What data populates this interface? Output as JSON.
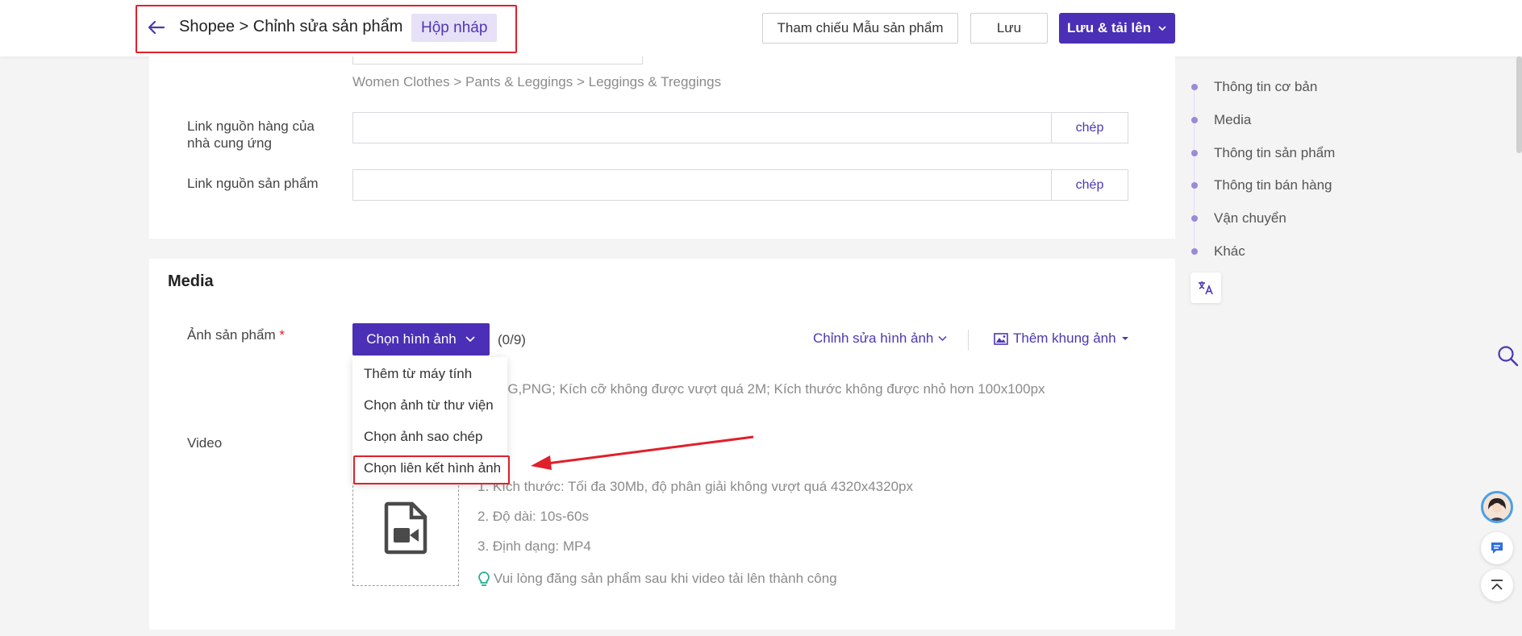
{
  "header": {
    "breadcrumb": "Shopee > Chỉnh sửa sản phẩm",
    "draft_badge": "Hộp nháp",
    "reference_button": "Tham chiếu Mẫu sản phẩm",
    "save_button": "Lưu",
    "save_upload_button": "Lưu & tải lên"
  },
  "basic": {
    "category_path": "Women Clothes > Pants & Leggings > Leggings & Treggings",
    "supplier_link_label": "Link nguồn hàng của nhà cung ứng",
    "supplier_link_value": "",
    "supplier_copy": "chép",
    "product_link_label": "Link nguồn sản phẩm",
    "product_link_value": "",
    "product_copy": "chép"
  },
  "media": {
    "title": "Media",
    "images_label": "Ảnh sản phẩm",
    "required_mark": "*",
    "choose_images_button": "Chọn hình ảnh",
    "image_count": "(0/9)",
    "edit_images": "Chỉnh sửa hình ảnh",
    "add_frame": "Thêm khung ảnh",
    "image_hint": "EG,PNG; Kích cỡ không được vượt quá 2M; Kích thước không được nhỏ hơn 100x100px",
    "dropdown": [
      "Thêm từ máy tính",
      "Chọn ảnh từ thư viện",
      "Chọn ảnh sao chép",
      "Chọn liên kết hình ảnh"
    ],
    "video_label": "Video",
    "video_req_1": "1. Kích thước: Tối đa 30Mb, độ phân giải không vượt quá 4320x4320px",
    "video_req_2": "2. Độ dài: 10s-60s",
    "video_req_3": "3. Định dạng: MP4",
    "video_tip": "Vui lòng đăng sản phẩm sau khi video tải lên thành công"
  },
  "right_nav": [
    "Thông tin cơ bản",
    "Media",
    "Thông tin sản phẩm",
    "Thông tin bán hàng",
    "Vận chuyển",
    "Khác"
  ],
  "colors": {
    "brand": "#4b2fb6",
    "highlight": "#e0202a"
  },
  "icons": {
    "back": "arrow-left-icon",
    "video": "video-file-icon",
    "tip": "lightbulb-icon",
    "translate": "translate-icon",
    "search": "search-icon",
    "chat": "chat-icon",
    "top": "back-to-top-icon"
  }
}
